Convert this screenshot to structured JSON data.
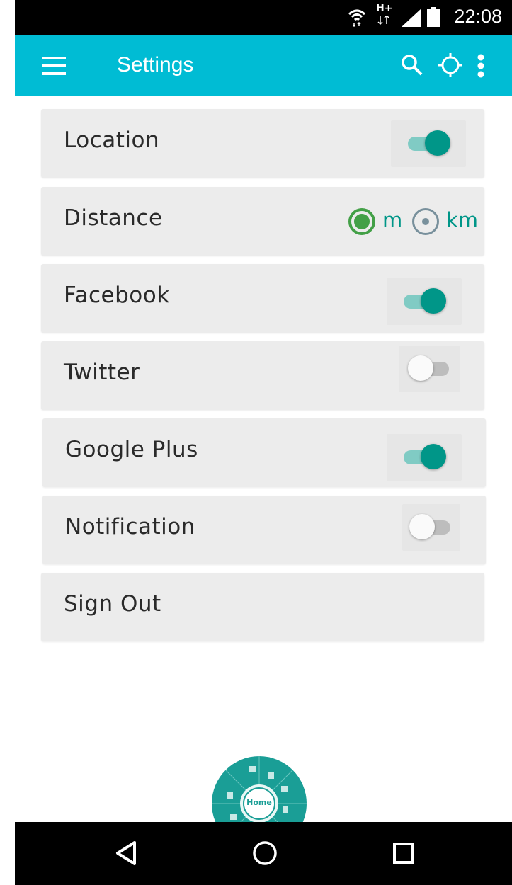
{
  "status_bar": {
    "time": "22:08",
    "icons": [
      "wifi-icon",
      "h-plus-data-icon",
      "signal-icon",
      "battery-icon"
    ],
    "network_label": "H+"
  },
  "app_bar": {
    "title": "Settings",
    "color": "#00bcd4",
    "actions": [
      "search-icon",
      "locate-icon",
      "more-vert-icon"
    ]
  },
  "settings": {
    "location": {
      "label": "Location",
      "on": true
    },
    "distance": {
      "label": "Distance",
      "options": [
        "m",
        "km"
      ],
      "selected": "m"
    },
    "facebook": {
      "label": "Facebook",
      "on": true
    },
    "twitter": {
      "label": "Twitter",
      "on": false
    },
    "google_plus": {
      "label": "Google Plus",
      "on": true
    },
    "notification": {
      "label": "Notification",
      "on": false
    },
    "sign_out": {
      "label": "Sign Out"
    }
  },
  "fab_wheel": {
    "center_label": "Home",
    "accent": "#1a9e96"
  },
  "accent_color": "#009688",
  "radio_selected_color": "#43a047"
}
